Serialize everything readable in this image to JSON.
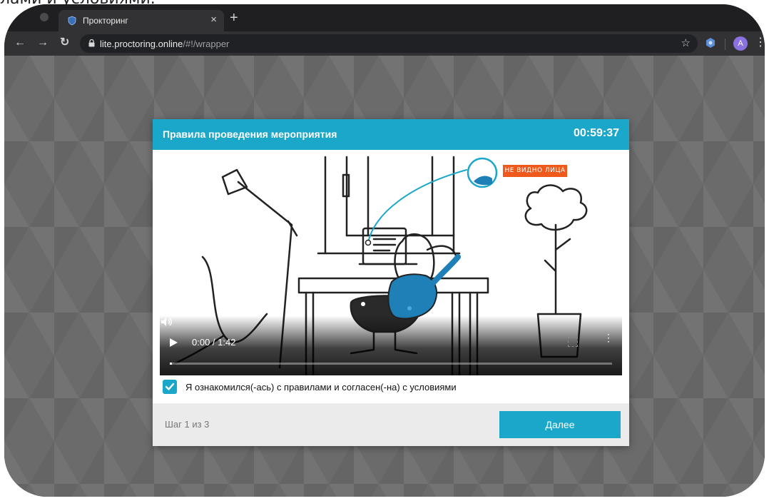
{
  "caption": {
    "top_text": "лами и условиями."
  },
  "browser": {
    "tab_title": "Прокторинг",
    "tab_close": "×",
    "new_tab": "+",
    "url_host": "lite.proctoring.online",
    "url_path": "/#!/wrapper",
    "avatar_letter": "A",
    "icons": [
      "back-icon",
      "forward-icon",
      "reload-icon",
      "lock-icon",
      "star-icon",
      "extension-icon",
      "menu-dots-icon"
    ]
  },
  "modal": {
    "title": "Правила проведения мероприятия",
    "timer": "00:59:37",
    "video": {
      "time": "0:00 / 1:42",
      "progress_fraction": 0.0,
      "illustration_badge": "НЕ ВИДНО ЛИЦА"
    },
    "agree_label": "Я ознакомился(-ась) с правилами и согласен(-на) с условиями",
    "agree_checked": true,
    "step_text": "Шаг 1 из 3",
    "next_button": "Далее"
  },
  "colors": {
    "accent": "#1ba7c9",
    "badge": "#ef5a1c",
    "chrome_dark": "#1f1f21"
  }
}
